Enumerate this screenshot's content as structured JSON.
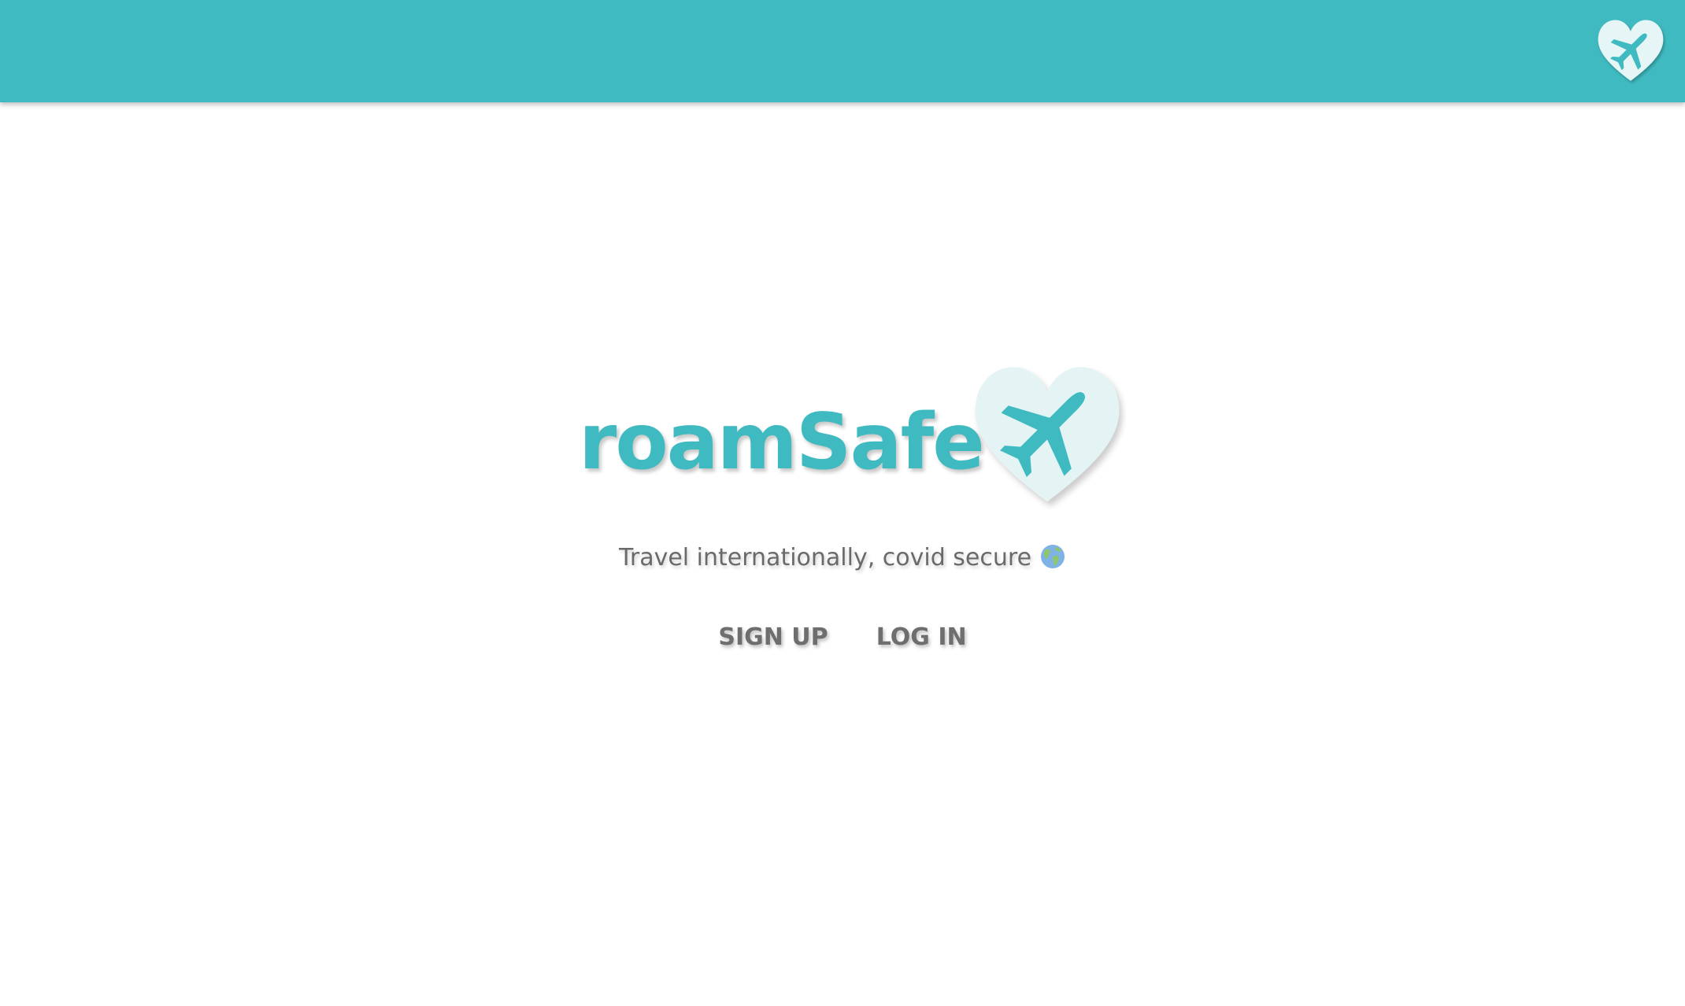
{
  "header": {
    "background_color": "#3fbac0",
    "logo_icon": "heart-airplane-icon"
  },
  "hero": {
    "brand_name": "roamSafe",
    "brand_color": "#3fbac0",
    "logo_icon": "heart-airplane-icon",
    "tagline": "Travel internationally, covid secure",
    "tagline_icon": "globe-icon"
  },
  "actions": {
    "signup_label": "SIGN UP",
    "login_label": "LOG IN"
  }
}
